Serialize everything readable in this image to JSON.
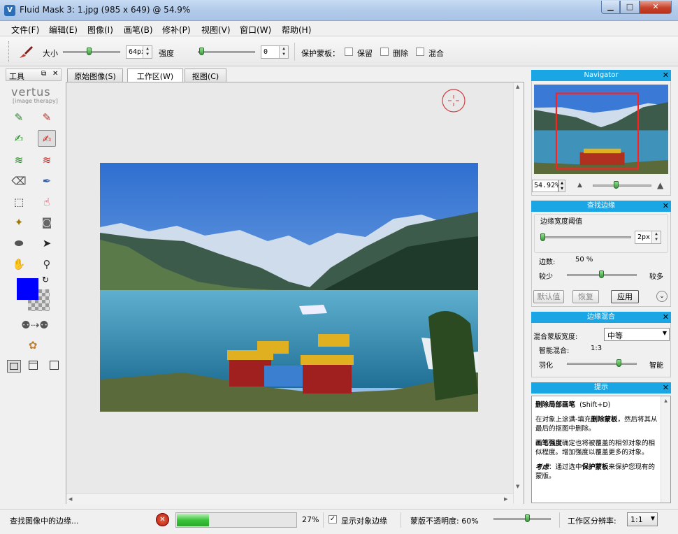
{
  "window": {
    "title": "Fluid Mask 3: 1.jpg (985 x 649) @ 54.9%",
    "icon_letter": "V",
    "min_glyph": "▁",
    "max_glyph": "□",
    "close_glyph": "✕"
  },
  "menu": [
    "文件(F)",
    "编辑(E)",
    "图像(I)",
    "画笔(B)",
    "修补(P)",
    "视图(V)",
    "窗口(W)",
    "帮助(H)"
  ],
  "toolbar": {
    "size_label": "大小",
    "size_value": "64px",
    "size_level": 0.45,
    "strength_label": "强度",
    "strength_value": "0",
    "strength_level": 0.02,
    "protect_label": "保护蒙板：",
    "options": [
      {
        "label": "保留",
        "checked": false
      },
      {
        "label": "删除",
        "checked": false
      },
      {
        "label": "混合",
        "checked": false
      }
    ]
  },
  "tools_panel": {
    "title": "工具",
    "brand": "vertus",
    "brand_sub": "[image therapy]",
    "fg_color": "#0000ff",
    "swap_icon": "↻"
  },
  "tabs": [
    {
      "label": "原始图像(S)",
      "active": false
    },
    {
      "label": "工作区(W)",
      "active": true
    },
    {
      "label": "抠图(C)",
      "active": false
    }
  ],
  "navigator": {
    "title": "Navigator",
    "zoom": "54.92%",
    "close": "✕"
  },
  "find_edges": {
    "title": "查找边缘",
    "close": "✕",
    "threshold_label": "边缘宽度阈值",
    "threshold_value": "2px",
    "edge_count_label": "边数:",
    "edge_count_value": "50 %",
    "fewer": "较少",
    "more": "较多",
    "buttons": [
      "默认值",
      "恢复",
      "应用"
    ]
  },
  "edge_blend": {
    "title": "边缘混合",
    "close": "✕",
    "width_label": "混合蒙版宽度:",
    "width_value": "中等",
    "smart_label": "智能混合:",
    "smart_value": "1:3",
    "feather": "羽化",
    "smart": "智能"
  },
  "hint": {
    "title": "提示",
    "close": "✕",
    "heading": "删除局部画笔",
    "shortcut": "(Shift+D)",
    "p1_a": "在对象上涂满-填充",
    "p1_b": "删除蒙板",
    "p1_c": "，然后将其从最后的抠图中删除。",
    "p2_a": "画笔强度",
    "p2_b": "确定也将被覆盖的相邻对象的相似程度。增加强度以覆盖更多的对象。",
    "p3_a": "考虑",
    "p3_b": "：通过选中",
    "p3_c": "保护蒙板",
    "p3_d": "来保护您现有的蒙版。"
  },
  "status": {
    "message": "查找图像中的边缘...",
    "progress": 0.27,
    "progress_text": "27%",
    "show_edges_label": "显示对象边缘",
    "show_edges_checked": true,
    "opacity_label": "蒙版不透明度: 60%",
    "opacity_level": 0.6,
    "resolution_label": "工作区分辨率:",
    "resolution_value": "1:1"
  }
}
